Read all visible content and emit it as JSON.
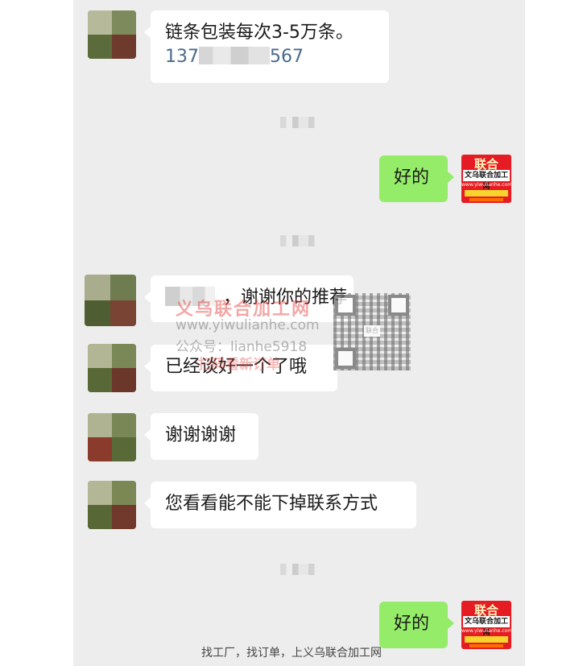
{
  "messages": [
    {
      "side": "left",
      "text": "链条包装每次3-5万条。",
      "phone_prefix": "137",
      "phone_suffix": "567"
    },
    {
      "side": "right",
      "text": "好的"
    },
    {
      "side": "left",
      "text": "，谢谢你的推荐"
    },
    {
      "side": "left",
      "text": "已经谈好一个了哦"
    },
    {
      "side": "left",
      "text": "谢谢谢谢"
    },
    {
      "side": "left",
      "text": "您看看能不能下掉联系方式"
    },
    {
      "side": "right",
      "text": "好的"
    }
  ],
  "brand_avatar": {
    "big": "联合",
    "band": "文乌联合加工网",
    "sub": "www.yiwulianhe.com"
  },
  "watermark": {
    "title": "义乌联合加工网",
    "url": "www.yiwulianhe.com",
    "account": "公众号：lianhe5918",
    "scan": "扫码看新订单",
    "qr_center": "联合"
  },
  "footer": "找工厂，找订单，上义乌联合加工网",
  "colors": {
    "chat_bg": "#ededed",
    "bubble_right": "#95ec69",
    "bubble_left": "#ffffff",
    "brand_red": "#e51c23"
  }
}
